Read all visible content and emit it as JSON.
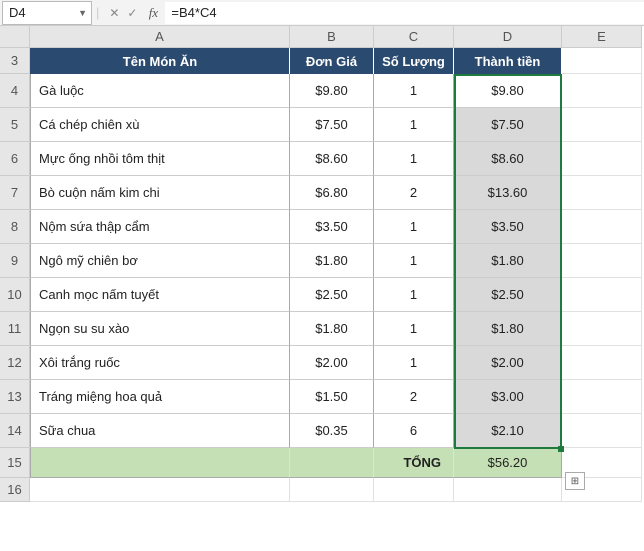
{
  "formula_bar": {
    "name_box": "D4",
    "formula": "=B4*C4",
    "fx_label": "fx",
    "cancel": "✕",
    "confirm": "✓"
  },
  "columns": [
    "A",
    "B",
    "C",
    "D",
    "E"
  ],
  "row_numbers": [
    "3",
    "4",
    "5",
    "6",
    "7",
    "8",
    "9",
    "10",
    "11",
    "12",
    "13",
    "14",
    "15",
    "16"
  ],
  "headers": {
    "a": "Tên Món Ăn",
    "b": "Đơn Giá",
    "c": "Số Lượng",
    "d": "Thành tiền"
  },
  "rows": [
    {
      "a": "Gà luộc",
      "b": "$9.80",
      "c": "1",
      "d": "$9.80"
    },
    {
      "a": "Cá chép chiên xù",
      "b": "$7.50",
      "c": "1",
      "d": "$7.50"
    },
    {
      "a": "Mực ống nhồi tôm thịt",
      "b": "$8.60",
      "c": "1",
      "d": "$8.60"
    },
    {
      "a": "Bò cuộn nấm kim chi",
      "b": "$6.80",
      "c": "2",
      "d": "$13.60"
    },
    {
      "a": "Nộm sứa thập cẩm",
      "b": "$3.50",
      "c": "1",
      "d": "$3.50"
    },
    {
      "a": "Ngô mỹ chiên bơ",
      "b": "$1.80",
      "c": "1",
      "d": "$1.80"
    },
    {
      "a": "Canh mọc nấm tuyết",
      "b": "$2.50",
      "c": "1",
      "d": "$2.50"
    },
    {
      "a": "Ngọn su su xào",
      "b": "$1.80",
      "c": "1",
      "d": "$1.80"
    },
    {
      "a": "Xôi trắng ruốc",
      "b": "$2.00",
      "c": "1",
      "d": "$2.00"
    },
    {
      "a": "Tráng miệng hoa quả",
      "b": "$1.50",
      "c": "2",
      "d": "$3.00"
    },
    {
      "a": "Sữa chua",
      "b": "$0.35",
      "c": "6",
      "d": "$2.10"
    }
  ],
  "total": {
    "label": "TỔNG",
    "value": "$56.20"
  },
  "autofill_icon": "⊞",
  "chart_data": {
    "type": "table",
    "title": "Tên Món Ăn",
    "columns": [
      "Tên Món Ăn",
      "Đơn Giá",
      "Số Lượng",
      "Thành tiền"
    ],
    "rows": [
      [
        "Gà luộc",
        9.8,
        1,
        9.8
      ],
      [
        "Cá chép chiên xù",
        7.5,
        1,
        7.5
      ],
      [
        "Mực ống nhồi tôm thịt",
        8.6,
        1,
        8.6
      ],
      [
        "Bò cuộn nấm kim chi",
        6.8,
        2,
        13.6
      ],
      [
        "Nộm sứa thập cẩm",
        3.5,
        1,
        3.5
      ],
      [
        "Ngô mỹ chiên bơ",
        1.8,
        1,
        1.8
      ],
      [
        "Canh mọc nấm tuyết",
        2.5,
        1,
        2.5
      ],
      [
        "Ngọn su su xào",
        1.8,
        1,
        1.8
      ],
      [
        "Xôi trắng ruốc",
        2.0,
        1,
        2.0
      ],
      [
        "Tráng miệng hoa quả",
        1.5,
        2,
        3.0
      ],
      [
        "Sữa chua",
        0.35,
        6,
        2.1
      ]
    ],
    "total": {
      "label": "TỔNG",
      "value": 56.2
    }
  }
}
